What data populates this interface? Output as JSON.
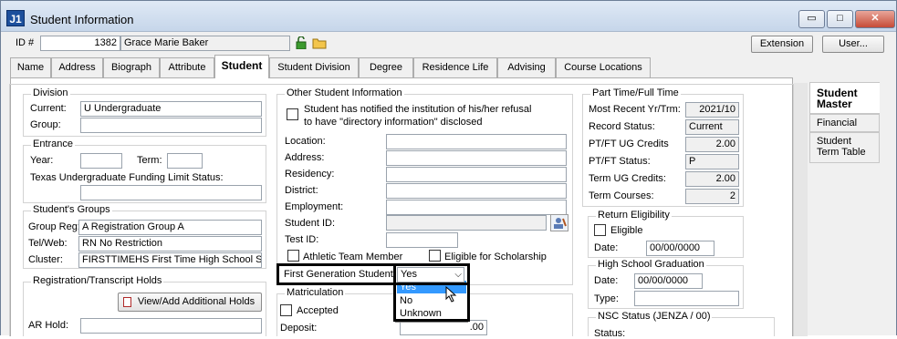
{
  "window": {
    "title": "Student Information",
    "app_icon": "J1",
    "controls": {
      "minimize": "▭",
      "maximize": "□",
      "close": "✕"
    }
  },
  "header": {
    "id_label": "ID #",
    "id_value": "1382",
    "name_value": "Grace Marie Baker",
    "extension_label": "Extension",
    "user_label": "User..."
  },
  "tabs": [
    "Name",
    "Address",
    "Biograph",
    "Attribute",
    "Student",
    "Student Division",
    "Degree",
    "Residence Life",
    "Advising",
    "Course Locations"
  ],
  "active_tab": "Student",
  "division": {
    "title": "Division",
    "current_label": "Current:",
    "current_value": "U Undergraduate",
    "group_label": "Group:",
    "group_value": ""
  },
  "entrance": {
    "title": "Entrance",
    "year_label": "Year:",
    "term_label": "Term:",
    "texas_label": "Texas Undergraduate Funding Limit Status:"
  },
  "groups": {
    "title": "Student's Groups",
    "group_reg_label": "Group Reg:",
    "group_reg_value": "A   Registration Group A",
    "telweb_label": "Tel/Web:",
    "telweb_value": "RN   No Restriction",
    "cluster_label": "Cluster:",
    "cluster_value": "FIRSTTIMEHS   First Time High School S"
  },
  "holds": {
    "title": "Registration/Transcript Holds",
    "view_button": "View/Add Additional Holds",
    "ar_label": "AR Hold:"
  },
  "other": {
    "title": "Other Student Information",
    "directory_text_1": "Student has notified the institution of his/her refusal",
    "directory_text_2": "to have \"directory information\" disclosed",
    "location_label": "Location:",
    "address_label": "Address:",
    "residency_label": "Residency:",
    "district_label": "District:",
    "employment_label": "Employment:",
    "student_id_label": "Student ID:",
    "test_id_label": "Test ID:",
    "athletic_label": "Athletic Team Member",
    "scholarship_label": "Eligible for Scholarship",
    "first_gen_label": "First Generation Student:",
    "first_gen_value": "Yes"
  },
  "dropdown": {
    "options": [
      "Yes",
      "No",
      "Unknown"
    ],
    "selected": "Yes"
  },
  "matriculation": {
    "title": "Matriculation",
    "accepted_label": "Accepted",
    "deposit_label": "Deposit:",
    "deposit_value": ".00"
  },
  "parttime": {
    "title": "Part Time/Full Time",
    "recent_label": "Most Recent Yr/Trm:",
    "recent_value": "2021/10",
    "status_label": "Record Status:",
    "status_value": "Current",
    "ug_credits_label": "PT/FT UG Credits",
    "ug_credits_value": "2.00",
    "ptft_label": "PT/FT Status:",
    "ptft_value": "P",
    "term_ug_label": "Term UG Credits:",
    "term_ug_value": "2.00",
    "term_courses_label": "Term Courses:",
    "term_courses_value": "2"
  },
  "return": {
    "title": "Return Eligibility",
    "eligible_label": "Eligible",
    "date_label": "Date:",
    "date_value": "00/00/0000"
  },
  "hs": {
    "title": "High School Graduation",
    "date_label": "Date:",
    "date_value": "00/00/0000",
    "type_label": "Type:"
  },
  "nsc": {
    "title": "NSC Status (JENZA / 00)",
    "status_label": "Status:"
  },
  "side_tabs": [
    "Student Master",
    "Financial",
    "Student Term Table"
  ]
}
